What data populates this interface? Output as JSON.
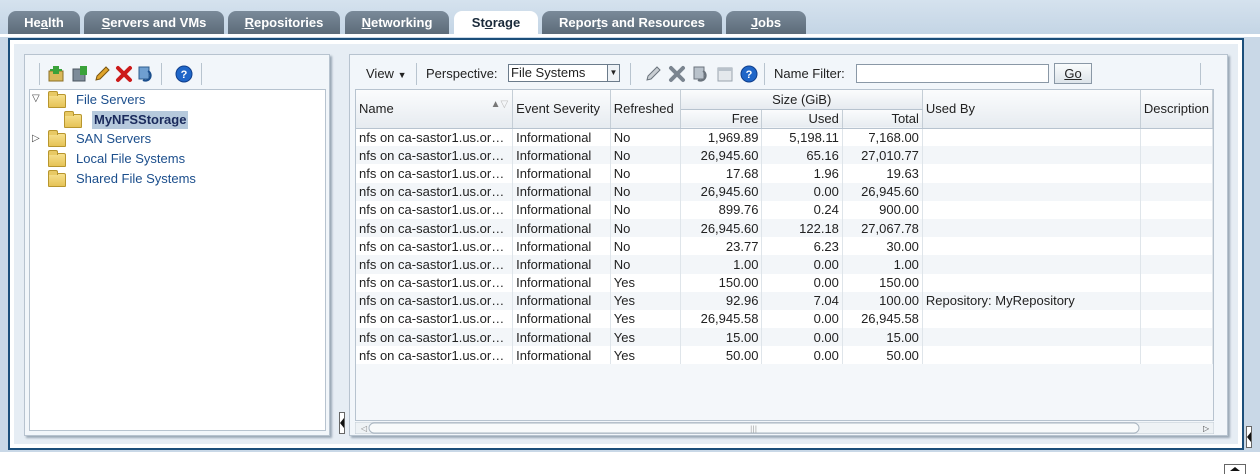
{
  "tabs": [
    {
      "label": "Health",
      "accel": "a"
    },
    {
      "label": "Servers and VMs",
      "accel": "S"
    },
    {
      "label": "Repositories",
      "accel": "R"
    },
    {
      "label": "Networking",
      "accel": "N"
    },
    {
      "label": "Storage",
      "accel": "o"
    },
    {
      "label": "Reports and Resources",
      "accel": "t"
    },
    {
      "label": "Jobs",
      "accel": "J"
    }
  ],
  "active_tab": "Storage",
  "tree": {
    "file_servers": "File Servers",
    "nfs_storage": "MyNFSStorage",
    "san_servers": "SAN Servers",
    "local_fs": "Local File Systems",
    "shared_fs": "Shared File Systems"
  },
  "toolbar": {
    "view": "View",
    "perspective_label": "Perspective:",
    "perspective_value": "File Systems",
    "name_filter_label": "Name Filter:",
    "name_filter_value": "",
    "go": "Go"
  },
  "columns": {
    "name": "Name",
    "event_severity": "Event Severity",
    "refreshed": "Refreshed",
    "size_group": "Size (GiB)",
    "free": "Free",
    "used": "Used",
    "total": "Total",
    "used_by": "Used By",
    "description": "Description"
  },
  "rows": [
    {
      "name": "nfs on ca-sastor1.us.or…",
      "severity": "Informational",
      "refreshed": "No",
      "free": "1,969.89",
      "used": "5,198.11",
      "total": "7,168.00",
      "used_by": ""
    },
    {
      "name": "nfs on ca-sastor1.us.or…",
      "severity": "Informational",
      "refreshed": "No",
      "free": "26,945.60",
      "used": "65.16",
      "total": "27,010.77",
      "used_by": ""
    },
    {
      "name": "nfs on ca-sastor1.us.or…",
      "severity": "Informational",
      "refreshed": "No",
      "free": "17.68",
      "used": "1.96",
      "total": "19.63",
      "used_by": ""
    },
    {
      "name": "nfs on ca-sastor1.us.or…",
      "severity": "Informational",
      "refreshed": "No",
      "free": "26,945.60",
      "used": "0.00",
      "total": "26,945.60",
      "used_by": ""
    },
    {
      "name": "nfs on ca-sastor1.us.or…",
      "severity": "Informational",
      "refreshed": "No",
      "free": "899.76",
      "used": "0.24",
      "total": "900.00",
      "used_by": ""
    },
    {
      "name": "nfs on ca-sastor1.us.or…",
      "severity": "Informational",
      "refreshed": "No",
      "free": "26,945.60",
      "used": "122.18",
      "total": "27,067.78",
      "used_by": ""
    },
    {
      "name": "nfs on ca-sastor1.us.or…",
      "severity": "Informational",
      "refreshed": "No",
      "free": "23.77",
      "used": "6.23",
      "total": "30.00",
      "used_by": ""
    },
    {
      "name": "nfs on ca-sastor1.us.or…",
      "severity": "Informational",
      "refreshed": "No",
      "free": "1.00",
      "used": "0.00",
      "total": "1.00",
      "used_by": ""
    },
    {
      "name": "nfs on ca-sastor1.us.or…",
      "severity": "Informational",
      "refreshed": "Yes",
      "free": "150.00",
      "used": "0.00",
      "total": "150.00",
      "used_by": ""
    },
    {
      "name": "nfs on ca-sastor1.us.or…",
      "severity": "Informational",
      "refreshed": "Yes",
      "free": "92.96",
      "used": "7.04",
      "total": "100.00",
      "used_by": "Repository: MyRepository"
    },
    {
      "name": "nfs on ca-sastor1.us.or…",
      "severity": "Informational",
      "refreshed": "Yes",
      "free": "26,945.58",
      "used": "0.00",
      "total": "26,945.58",
      "used_by": ""
    },
    {
      "name": "nfs on ca-sastor1.us.or…",
      "severity": "Informational",
      "refreshed": "Yes",
      "free": "15.00",
      "used": "0.00",
      "total": "15.00",
      "used_by": ""
    },
    {
      "name": "nfs on ca-sastor1.us.or…",
      "severity": "Informational",
      "refreshed": "Yes",
      "free": "50.00",
      "used": "0.00",
      "total": "50.00",
      "used_by": ""
    }
  ],
  "icons": {
    "left_toolbar": [
      "add-storage-icon",
      "discover-icon",
      "edit-icon",
      "delete-icon",
      "refresh-icon",
      "help-icon"
    ],
    "right_toolbar": [
      "edit-icon",
      "delete-icon",
      "refresh-icon",
      "calendar-icon",
      "help-icon"
    ]
  },
  "colors": {
    "accent": "#1b4e7a",
    "link": "#1b4e8c",
    "delete": "#cc1a1a",
    "help": "#1f66c8"
  }
}
